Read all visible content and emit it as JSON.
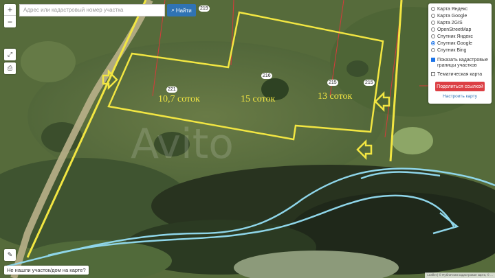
{
  "search": {
    "placeholder": "Адрес или кадастровый номер участка",
    "button_label": "Найти"
  },
  "zoom": {
    "in": "+",
    "out": "−"
  },
  "layers": {
    "base_options": [
      "Карта Яндекс",
      "Карта Google",
      "Карта 2GIS",
      "OpenStreetMap",
      "Спутник Яндекс",
      "Спутник Google",
      "Спутник Bing"
    ],
    "selected": "Спутник Google",
    "show_cadastral": "Показать кадастровые границы участков",
    "thematic": "Тематическая карта",
    "share_button": "Поделиться ссылкой",
    "setup_link": "Настроить карту"
  },
  "not_found": "Не нашли участок/дом на карте?",
  "parcels": [
    {
      "area": "10,7 соток",
      "number": "221"
    },
    {
      "area": "15 соток",
      "number": "216"
    },
    {
      "area": "13 соток",
      "number": "215"
    }
  ],
  "other_numbers": [
    "219",
    "215"
  ],
  "attribution": "Leaflet | © Публичная кадастровая карта, © ...",
  "colors": {
    "boundary": "#f2e642",
    "cadastral": "#d83a3a",
    "river": "#8fd6ea",
    "button_blue": "#2f73b4",
    "button_red": "#dc3f44"
  }
}
